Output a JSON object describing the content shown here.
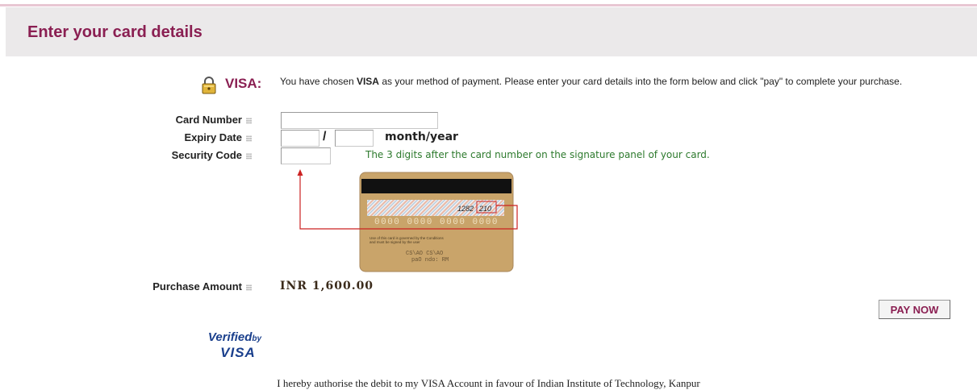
{
  "header": {
    "title": "Enter your card details"
  },
  "payment": {
    "method_label": "VISA:",
    "intro_prefix": "You have chosen ",
    "intro_method": "VISA",
    "intro_suffix": " as your method of payment. Please enter your card details into the form below and click \"pay\" to complete your purchase."
  },
  "form": {
    "card_number": {
      "label": "Card Number",
      "value": ""
    },
    "expiry": {
      "label": "Expiry Date",
      "month_value": "",
      "year_value": "",
      "separator": "/",
      "hint": "month/year"
    },
    "security_code": {
      "label": "Security Code",
      "value": "",
      "hint": "The 3 digits after the card number on the signature panel of your card."
    }
  },
  "card_illustration": {
    "signature_digits": "1282",
    "cvv_digits": "210",
    "card_number_digits": "0000 0000 0000 0000",
    "terms_line1": "Use of this card is governed by the Conditions",
    "terms_line2": "and must be signed by the user"
  },
  "purchase": {
    "label": "Purchase Amount",
    "amount": "INR 1,600.00"
  },
  "actions": {
    "pay_now_label": "PAY NOW"
  },
  "verified_by_visa": {
    "line1": "Verified",
    "by": "by",
    "line2": "VISA"
  },
  "footer": {
    "authorisation": "I hereby authorise the debit to my VISA Account in favour of Indian Institute of Technology, Kanpur"
  },
  "colors": {
    "accent": "#8a1f52",
    "hint_green": "#2d7a2d",
    "card_gold": "#c9a46a",
    "arrow_red": "#cc2222",
    "visa_blue": "#1a3f8c"
  }
}
